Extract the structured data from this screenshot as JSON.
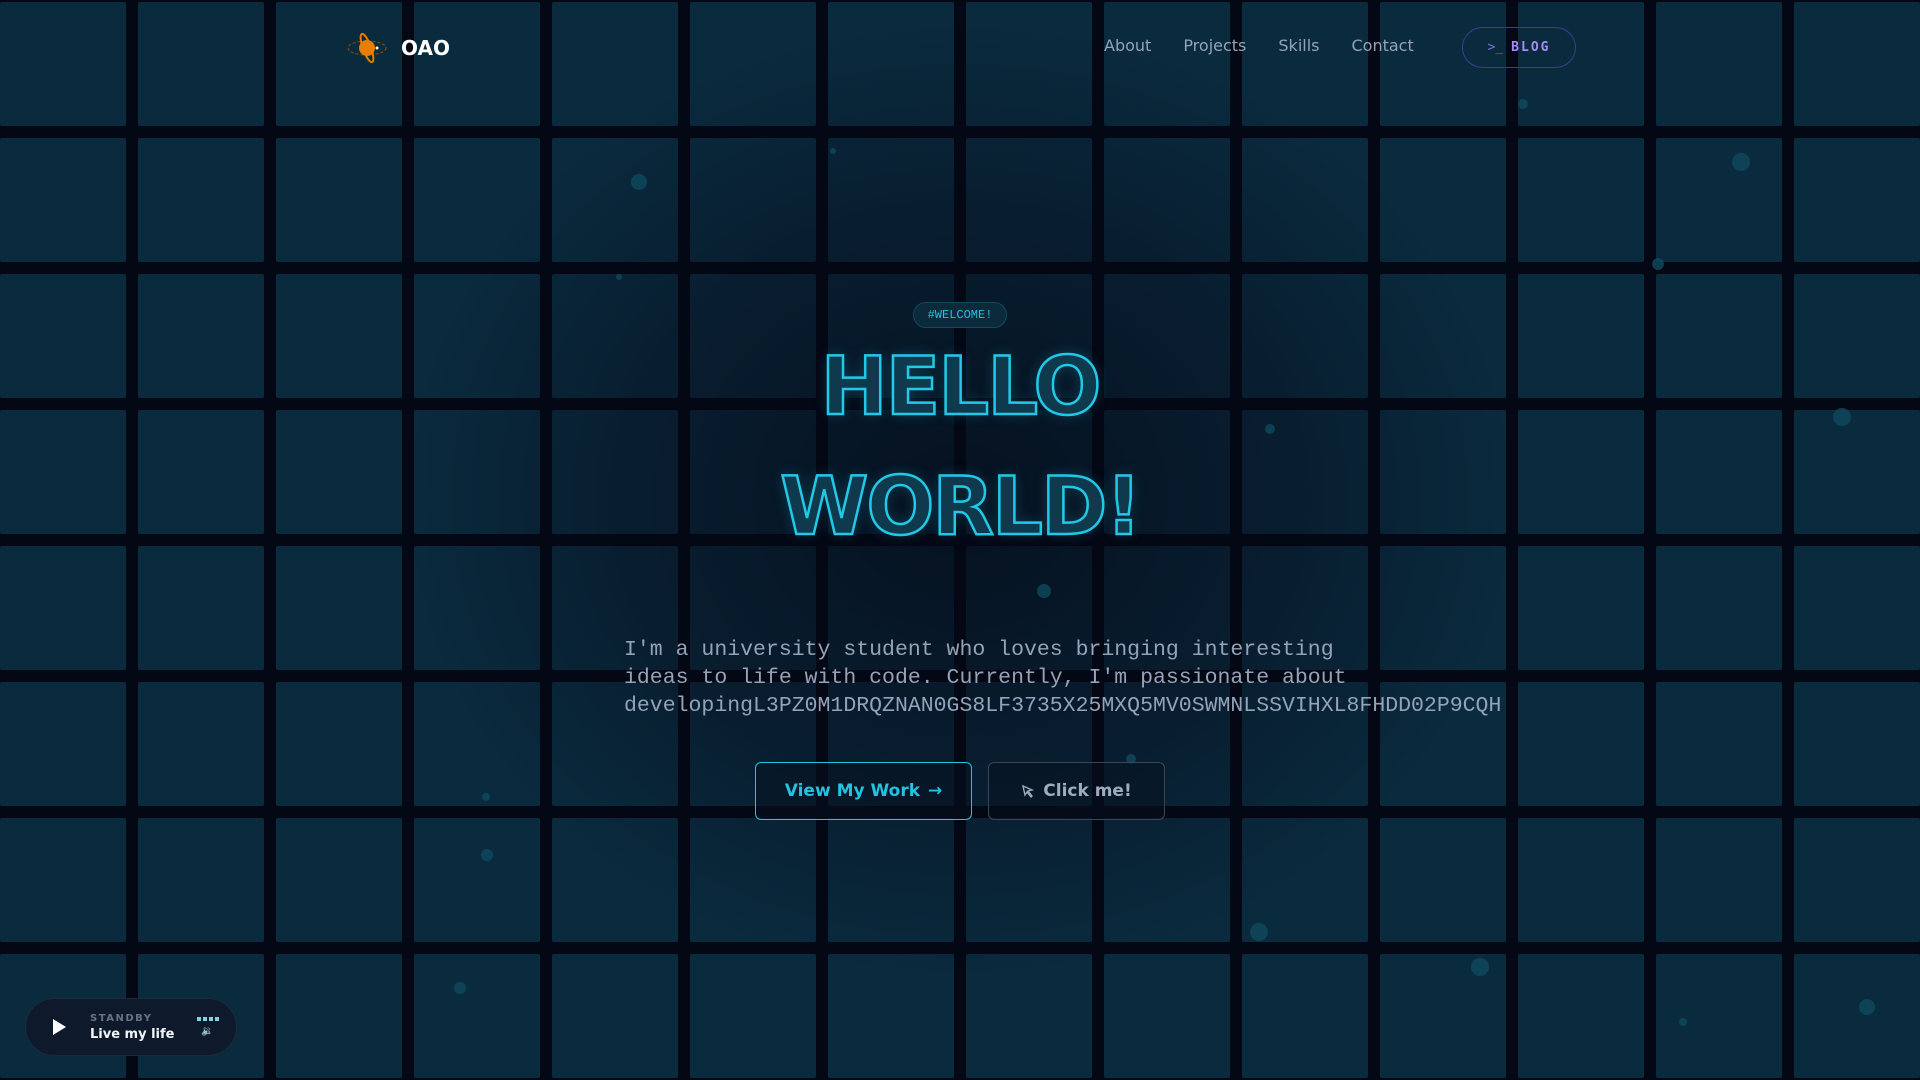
{
  "header": {
    "logo_text": "OAO",
    "nav": [
      "About",
      "Projects",
      "Skills",
      "Contact"
    ],
    "blog_prompt": ">_",
    "blog_label": "BLOG"
  },
  "hero": {
    "badge": "#WELCOME!",
    "line1": "HELLO",
    "line2": "WORLD!",
    "paragraph_lines": [
      "I'm a university student who loves bringing interesting",
      "ideas to life with code. Currently, I'm passionate about",
      "developingL3PZ0M1DRQZNAN0GS8LF3735X25MXQ5MV0SWMNLSSVIHXL8FHDD02P9CQH"
    ],
    "primary_button": "View My Work",
    "primary_icon": "→",
    "secondary_button": "Click me!"
  },
  "player": {
    "status": "STANDBY",
    "track": "Live my life",
    "volume_icon": "🔉"
  },
  "colors": {
    "accent": "#22c8e8",
    "blog": "#a78bfa",
    "logo": "#e67e00"
  }
}
